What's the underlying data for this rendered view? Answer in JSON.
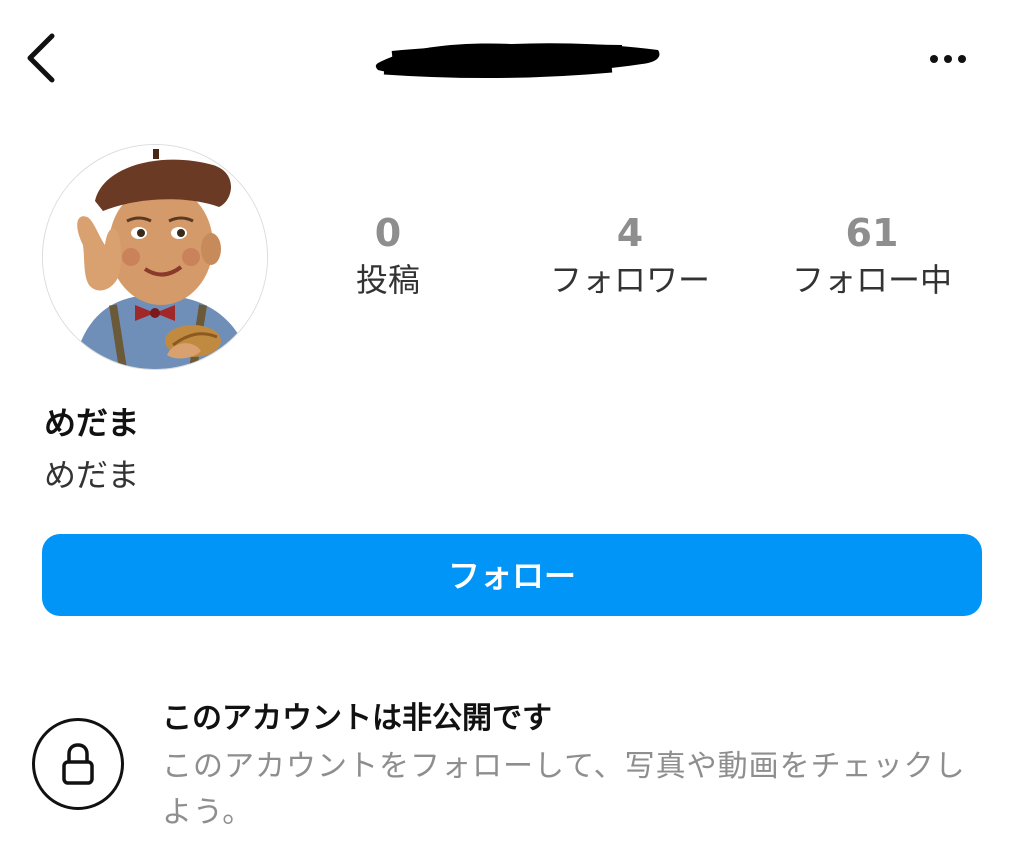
{
  "header": {
    "back_icon": "chevron-left-icon",
    "username": "",
    "more_icon": "more-horizontal-icon"
  },
  "profile": {
    "avatar": "profile-avatar-illustration",
    "stats": {
      "posts": {
        "value": "0",
        "label": "投稿"
      },
      "followers": {
        "value": "4",
        "label": "フォロワー"
      },
      "following": {
        "value": "61",
        "label": "フォロー中"
      }
    },
    "display_name": "めだま",
    "bio": "めだま"
  },
  "actions": {
    "follow_label": "フォロー",
    "accent_color": "#0095f6"
  },
  "private_notice": {
    "icon": "lock-icon",
    "title": "このアカウントは非公開です",
    "description": "このアカウントをフォローして、写真や動画をチェックしよう。"
  }
}
